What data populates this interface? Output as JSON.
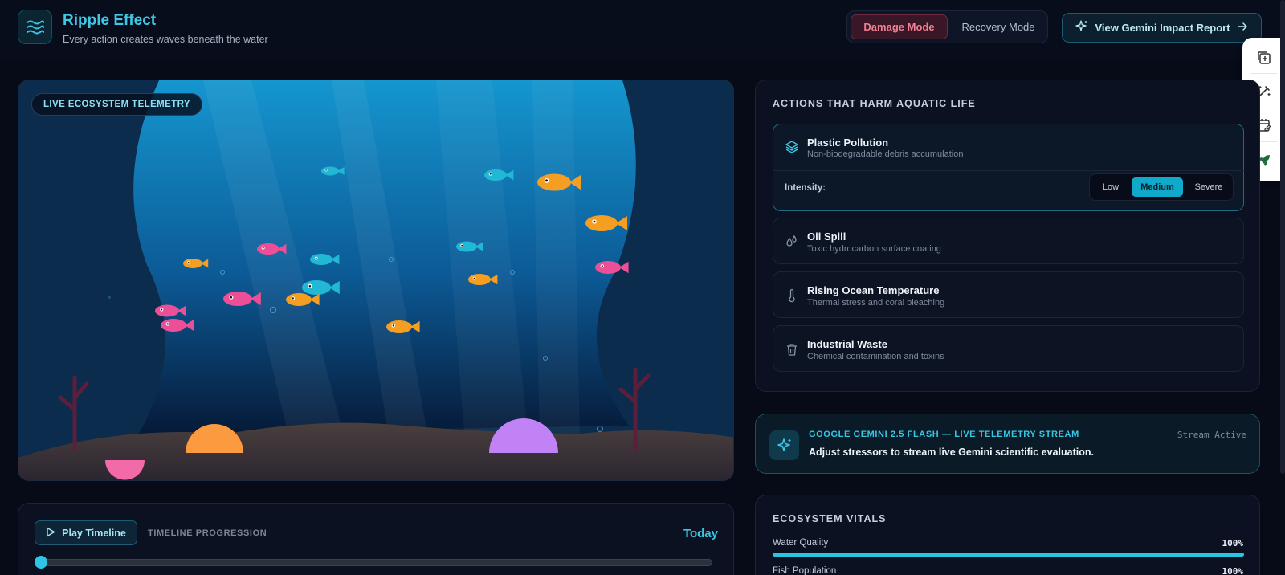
{
  "header": {
    "title": "Ripple Effect",
    "subtitle": "Every action creates waves beneath the water",
    "modes": {
      "damage": "Damage Mode",
      "recovery": "Recovery Mode",
      "active": "damage"
    },
    "report_button": "View Gemini Impact Report"
  },
  "tank": {
    "badge": "LIVE ECOSYSTEM TELEMETRY"
  },
  "actions": {
    "heading": "ACTIONS THAT HARM AQUATIC LIFE",
    "items": [
      {
        "title": "Plastic Pollution",
        "subtitle": "Non-biodegradable debris accumulation",
        "icon": "layers-icon",
        "selected": true
      },
      {
        "title": "Oil Spill",
        "subtitle": "Toxic hydrocarbon surface coating",
        "icon": "droplets-icon"
      },
      {
        "title": "Rising Ocean Temperature",
        "subtitle": "Thermal stress and coral bleaching",
        "icon": "thermometer-icon"
      },
      {
        "title": "Industrial Waste",
        "subtitle": "Chemical contamination and toxins",
        "icon": "trash-icon"
      }
    ],
    "intensity": {
      "label": "Intensity:",
      "options": [
        "Low",
        "Medium",
        "Severe"
      ],
      "selected": "Medium"
    }
  },
  "gemini": {
    "title": "GOOGLE GEMINI 2.5 FLASH — LIVE TELEMETRY STREAM",
    "status": "Stream Active",
    "message": "Adjust stressors to stream live Gemini scientific evaluation."
  },
  "vitals": {
    "heading": "ECOSYSTEM VITALS",
    "items": [
      {
        "label": "Water Quality",
        "value": "100%",
        "level": 1.0
      },
      {
        "label": "Fish Population",
        "value": "100%",
        "level": 1.0
      }
    ]
  },
  "timeline": {
    "play_label": "Play Timeline",
    "label": "TIMELINE PROGRESSION",
    "current": "Today",
    "position": 0
  },
  "colors": {
    "accent": "#29c6e3",
    "damage": "#f07f93",
    "background": "#070b18"
  }
}
